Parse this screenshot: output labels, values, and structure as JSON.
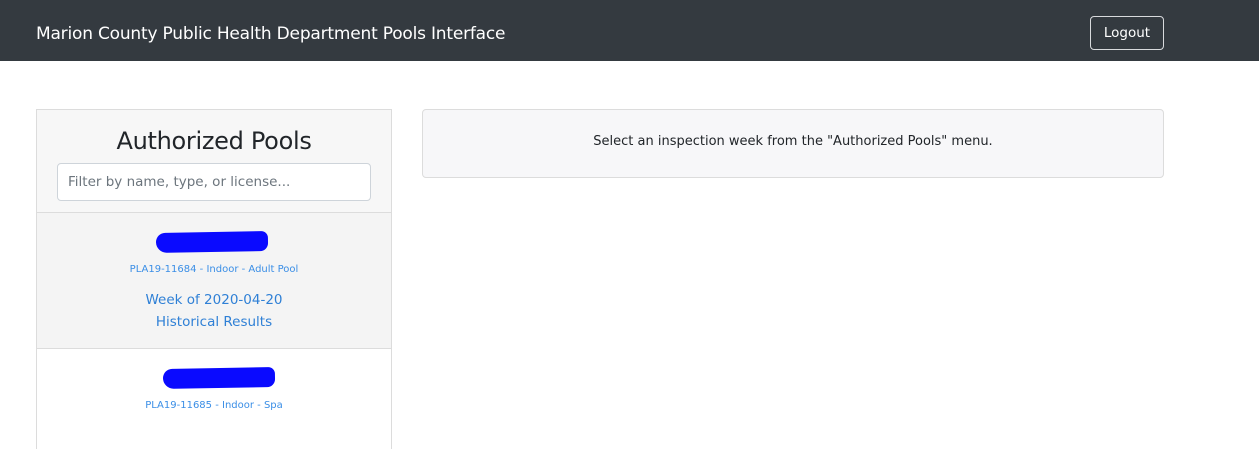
{
  "header": {
    "title": "Marion County Public Health Department Pools Interface",
    "logout_label": "Logout"
  },
  "sidebar": {
    "title": "Authorized Pools",
    "filter_placeholder": "Filter by name, type, or license...",
    "items": [
      {
        "license": "PLA19-11684 - Indoor - Adult Pool",
        "week": "Week of 2020-04-20",
        "history": "Historical Results"
      },
      {
        "license": "PLA19-11685 - Indoor - Spa"
      }
    ]
  },
  "main": {
    "message": "Select an inspection week from the \"Authorized Pools\" menu."
  },
  "colors": {
    "navbar": "#343a40",
    "link": "#2f80d6",
    "redaction": "#0a0aff"
  }
}
